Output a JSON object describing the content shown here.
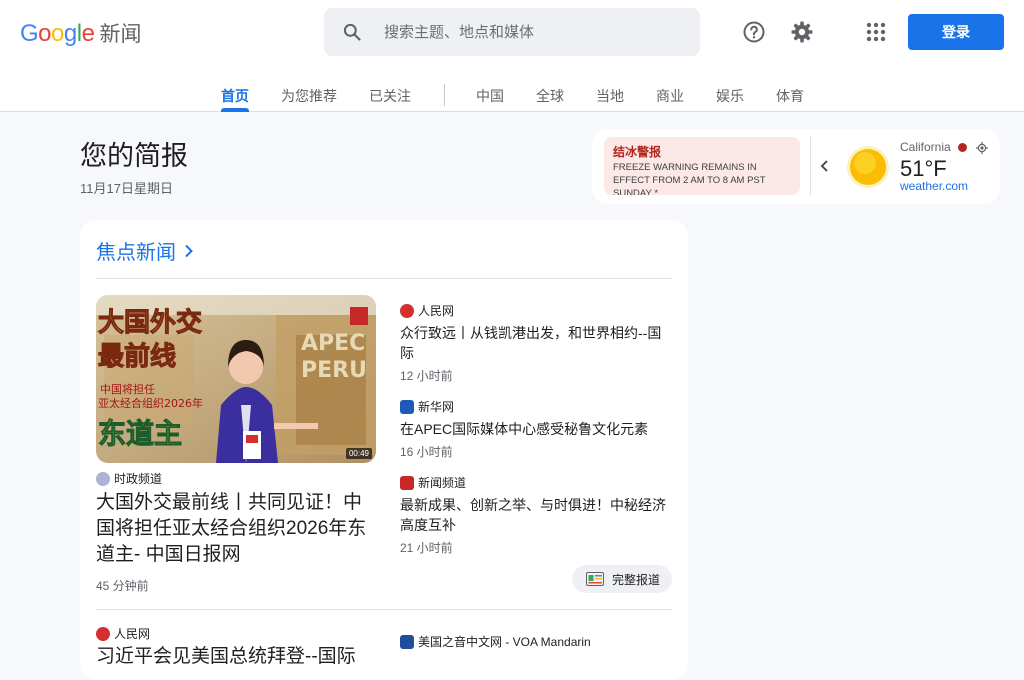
{
  "header": {
    "logo_word": "Google",
    "product_name": "新闻",
    "search_placeholder": "搜索主题、地点和媒体",
    "login_label": "登录"
  },
  "tabs": [
    {
      "label": "首页",
      "active": true
    },
    {
      "label": "为您推荐"
    },
    {
      "label": "已关注"
    },
    {
      "label": "中国"
    },
    {
      "label": "全球"
    },
    {
      "label": "当地"
    },
    {
      "label": "商业"
    },
    {
      "label": "娱乐"
    },
    {
      "label": "体育"
    }
  ],
  "briefing": {
    "title": "您的简报",
    "date": "11月17日星期日"
  },
  "weather": {
    "alert_title": "结冰警报",
    "alert_text": "FREEZE WARNING REMAINS IN EFFECT FROM 2 AM TO 8 AM PST SUNDAY *...",
    "location": "California",
    "temperature": "51°F",
    "source": "weather.com"
  },
  "top_stories": {
    "section_title": "焦点新闻",
    "main_story": {
      "video_duration": "00:49",
      "source": "时政频道",
      "headline": "大国外交最前线丨共同见证！中国将担任亚太经合组织2026年东道主- 中国日报网",
      "time": "45 分钟前"
    },
    "related": [
      {
        "source": "人民网",
        "headline": "众行致远丨从钱凯港出发，和世界相约--国际",
        "time": "12 小时前"
      },
      {
        "source": "新华网",
        "headline": "在APEC国际媒体中心感受秘鲁文化元素",
        "time": "16 小时前"
      },
      {
        "source": "新闻频道",
        "headline": "最新成果、创新之举、与时俱进！中秘经济高度互补",
        "time": "21 小时前"
      }
    ],
    "full_coverage_label": "完整报道",
    "next_story": {
      "source": "人民网",
      "headline": "习近平会见美国总统拜登--国际",
      "right_source": "美国之音中文网 - VOA Mandarin"
    }
  },
  "colors": {
    "accent": "#1a73e8",
    "alert_bg": "#fce8e6",
    "alert_text": "#b3261e",
    "page_bg": "#f6f8fc"
  }
}
